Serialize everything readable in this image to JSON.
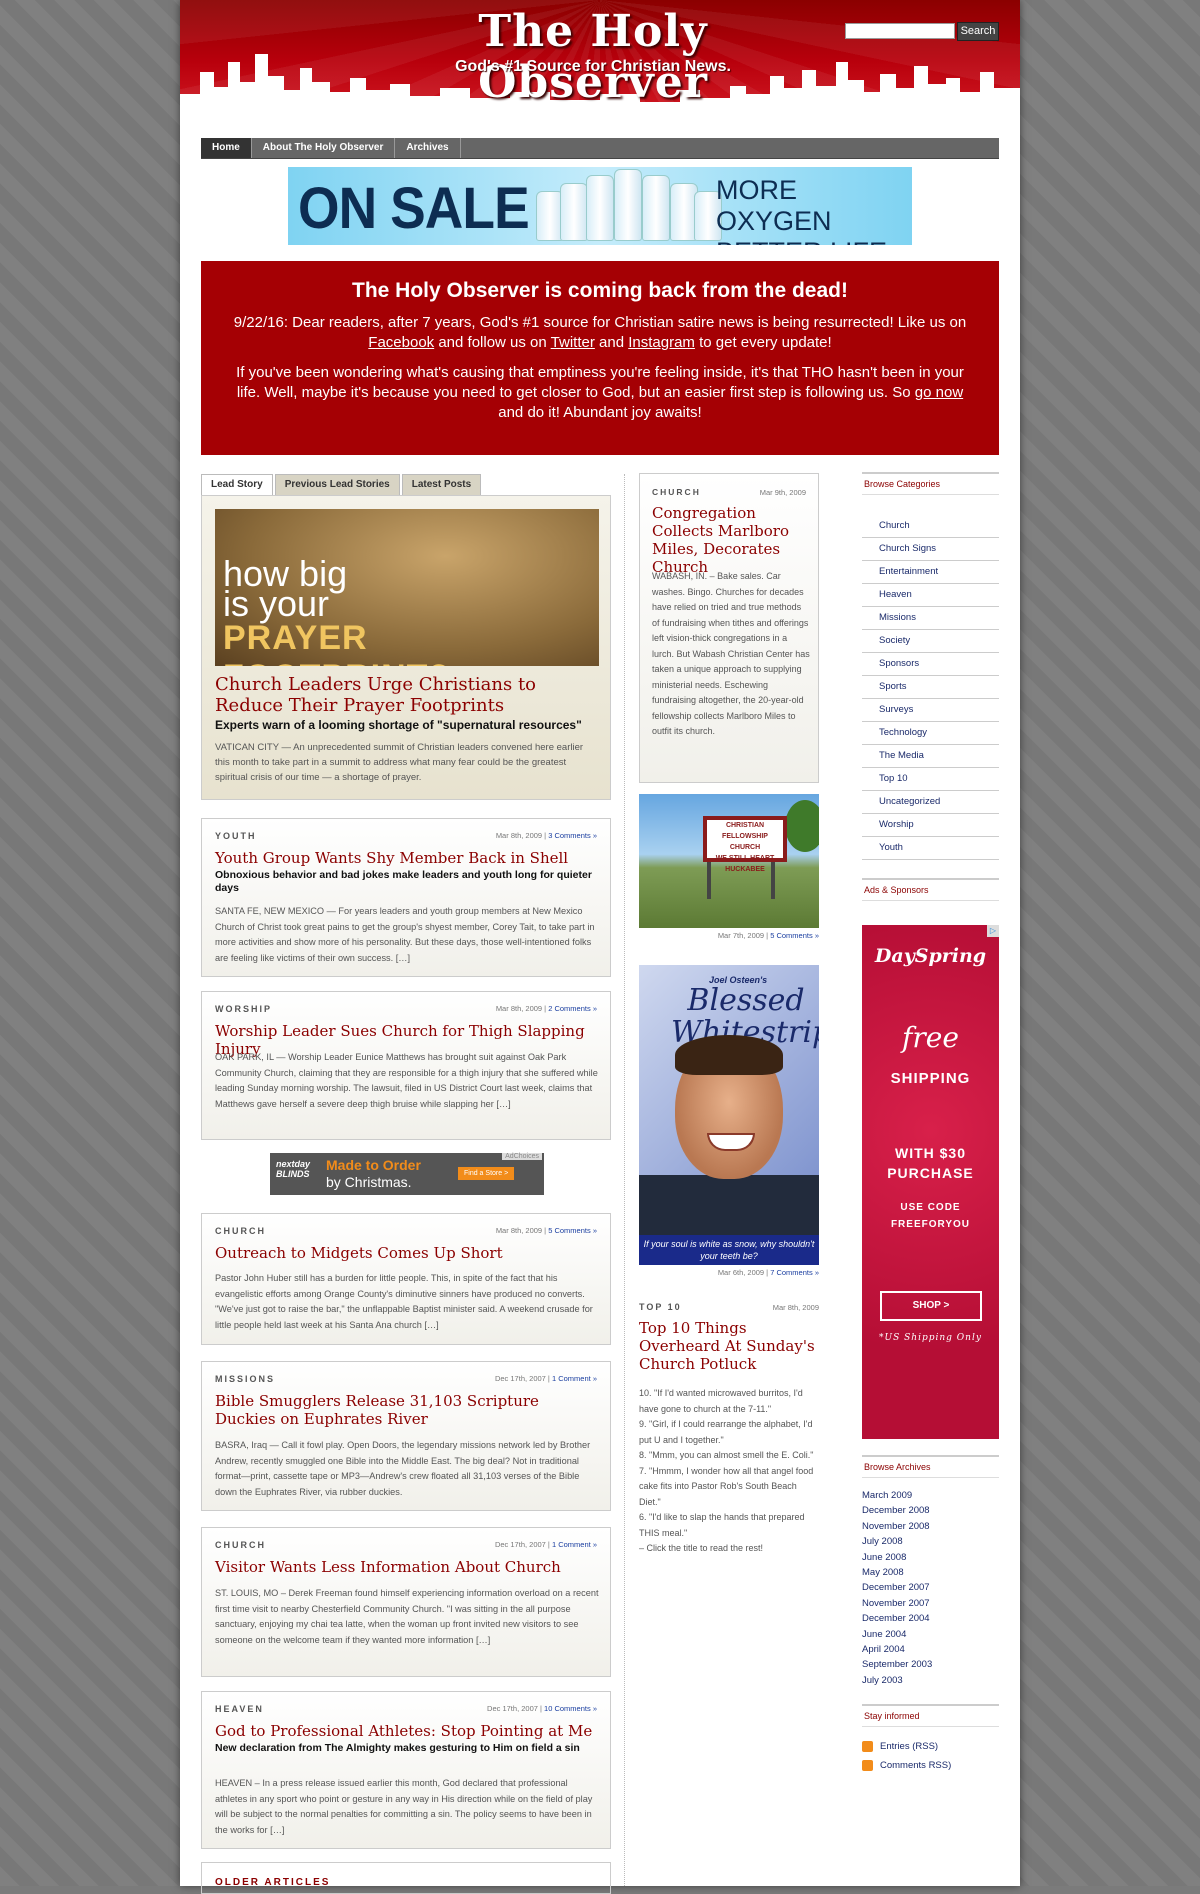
{
  "header": {
    "logo": "The Holy Observer",
    "tagline": "God's #1 Source for Christian News.",
    "search_button": "Search",
    "search_value": ""
  },
  "nav": [
    {
      "label": "Home"
    },
    {
      "label": "About The Holy Observer"
    },
    {
      "label": "Archives"
    }
  ],
  "banner_ad": {
    "headline": "ON SALE",
    "slogan_line1": "MORE OXYGEN",
    "slogan_line2": "BETTER LIFE",
    "accent": "#0d2d52"
  },
  "announcement": {
    "title": "The Holy Observer is coming back from the dead!",
    "p1_before": "9/22/16: Dear readers, after 7 years, God's #1 source for Christian satire news is being resurrected! Like us on ",
    "p1_link1": "Facebook",
    "p1_mid1": " and follow us on ",
    "p1_link2": "Twitter",
    "p1_mid2": " and ",
    "p1_link3": "Instagram",
    "p1_after": " to get every update!",
    "p2_before": "If you've been wondering what's causing that emptiness you're feeling inside, it's that THO hasn't been in your life. Well, maybe it's because you need to get closer to God, but an easier first step is following us. So ",
    "p2_link": "go now",
    "p2_after": " and do it! Abundant joy awaits!",
    "background": "#a50004"
  },
  "tabs": [
    {
      "label": "Lead Story"
    },
    {
      "label": "Previous Lead Stories"
    },
    {
      "label": "Latest Posts"
    }
  ],
  "lead": {
    "image_line1": "how big",
    "image_line2": "is your",
    "image_line3": "PRAYER FOOTPRINT?",
    "title": "Church Leaders Urge Christians to Reduce Their Prayer Footprints",
    "dek": "Experts warn of a looming shortage of \"supernatural resources\"",
    "excerpt": "VATICAN CITY — An unprecedented summit of Christian leaders convened here earlier this month to take part in a summit to address what many fear could be the greatest spiritual crisis of our time — a shortage of prayer."
  },
  "posts": [
    {
      "category": "YOUTH",
      "date": "Mar 8th, 2009 | ",
      "comments": "3 Comments »",
      "title": "Youth Group Wants Shy Member Back in Shell",
      "dek": "Obnoxious behavior and bad jokes make leaders and youth long for quieter days",
      "excerpt": "SANTA FE, NEW MEXICO — For years leaders and youth group members at New Mexico Church of Christ took great pains to get the group's shyest member, Corey Tait, to take part in more activities and show more of his personality. But these days, those well-intentioned folks are feeling like victims of their own success. […]"
    },
    {
      "category": "WORSHIP",
      "date": "Mar 8th, 2009 | ",
      "comments": "2 Comments »",
      "title": "Worship Leader Sues Church for Thigh Slapping Injury",
      "dek": "",
      "excerpt": "OAK PARK, IL — Worship Leader Eunice Matthews has brought suit against Oak Park Community Church, claiming that they are responsible for a thigh injury that she suffered while leading Sunday morning worship. The lawsuit, filed in US District Court last week, claims that Matthews gave herself a severe deep thigh bruise while slapping her […]"
    },
    {
      "category": "CHURCH",
      "date": "Mar 8th, 2009 | ",
      "comments": "5 Comments »",
      "title": "Outreach to Midgets Comes Up Short",
      "dek": "",
      "excerpt": "Pastor John Huber still has a burden for little people. This, in spite of the fact that his evangelistic efforts among Orange County's diminutive sinners have produced no converts. \"We've just got to raise the bar,\" the unflappable Baptist minister said. A weekend crusade for little people held last week at his Santa Ana church […]"
    },
    {
      "category": "MISSIONS",
      "date": "Dec 17th, 2007 | ",
      "comments": "1 Comment »",
      "title": "Bible Smugglers Release 31,103 Scripture Duckies on Euphrates River",
      "dek": "",
      "excerpt": "BASRA, Iraq — Call it fowl play. Open Doors, the legendary missions network led by Brother Andrew, recently smuggled one Bible into the Middle East. The big deal? Not in traditional format—print, cassette tape or MP3—Andrew's crew floated all 31,103 verses of the Bible down the Euphrates River, via rubber duckies."
    },
    {
      "category": "CHURCH",
      "date": "Dec 17th, 2007 | ",
      "comments": "1 Comment »",
      "title": "Visitor Wants Less Information About Church",
      "dek": "",
      "excerpt": "ST. LOUIS, MO – Derek Freeman found himself experiencing information overload on a recent first time visit to nearby Chesterfield Community Church. \"I was sitting in the all purpose sanctuary, enjoying my chai tea latte, when the woman up front invited new visitors to see someone on the welcome team if they wanted more information […]"
    },
    {
      "category": "HEAVEN",
      "date": "Dec 17th, 2007 | ",
      "comments": "10 Comments »",
      "title": "God to Professional Athletes: Stop Pointing at Me",
      "dek": "New declaration from The Almighty makes gesturing to Him on field a sin",
      "excerpt": "HEAVEN – In a press release issued earlier this month, God declared that professional athletes in any sport who point or gesture in any way in His direction while on the field of play will be subject to the normal penalties for committing a sin. The policy seems to have been in the works for […]"
    }
  ],
  "mid_ad": {
    "brand": "nextday BLINDS",
    "line1": "Made to Order",
    "line2": "by Christmas.",
    "cta": "Find a Store >",
    "adchoices": "AdChoices"
  },
  "older_articles": "OLDER ARTICLES",
  "mid_column": {
    "feature": {
      "category": "CHURCH",
      "date": "Mar 9th, 2009",
      "title": "Congregation Collects Marlboro Miles, Decorates Church",
      "excerpt": "WABASH, IN. – Bake sales. Car washes. Bingo. Churches for decades have relied on tried and true methods of fundraising when tithes and offerings left vision-thick congregations in a lurch. But Wabash Christian Center has taken a unique approach to supplying ministerial needs. Eschewing fundraising altogether, the 20-year-old fellowship collects Marlboro Miles to outfit its church."
    },
    "sign_photo": {
      "sign_line1": "CHRISTIAN FELLOWSHIP CHURCH",
      "sign_line2": "WE STILL HEART HUCKABEE",
      "date": "Mar 7th, 2009 | ",
      "comments": "5 Comments »"
    },
    "osteen_ad": {
      "byline": "Joel Osteen's",
      "title_line1": "Blessed",
      "title_line2": "Whitestrips",
      "quote": "If your soul is white as snow, why shouldn't your teeth be?",
      "date": "Mar 6th, 2009 | ",
      "comments": "7 Comments »"
    },
    "top10": {
      "category": "TOP 10",
      "date": "Mar 8th, 2009",
      "title": "Top 10 Things Overheard At Sunday's Church Potluck",
      "lines": [
        "10. \"If I'd wanted microwaved burritos, I'd have gone to church at the 7-11.\"",
        "9. \"Girl, if I could rearrange the alphabet, I'd put U and I together.\"",
        "8. \"Mmm, you can almost smell the E. Coli.\"",
        "7. \"Hmmm, I wonder how all that angel food cake fits into Pastor Rob's South Beach Diet.\"",
        "6. \"I'd like to slap the hands that prepared THIS meal.\"",
        "– Click the title to read the rest!"
      ]
    }
  },
  "sidebar": {
    "categories_title": "Browse Categories",
    "categories": [
      "Church",
      "Church Signs",
      "Entertainment",
      "Heaven",
      "Missions",
      "Society",
      "Sponsors",
      "Sports",
      "Surveys",
      "Technology",
      "The Media",
      "Top 10",
      "Uncategorized",
      "Worship",
      "Youth"
    ],
    "ads_title": "Ads & Sponsors",
    "dayspring": {
      "brand": "DaySpring",
      "free": "free",
      "shipping": "SHIPPING",
      "with_line1": "WITH $30",
      "with_line2": "PURCHASE",
      "code_line1": "USE CODE",
      "code_line2": "FREEFORYOU",
      "shop": "SHOP  >",
      "us": "*US Shipping Only"
    },
    "archives_title": "Browse Archives",
    "archives": [
      "March 2009",
      "December 2008",
      "November 2008",
      "July 2008",
      "June 2008",
      "May 2008",
      "December 2007",
      "November 2007",
      "December 2004",
      "June 2004",
      "April 2004",
      "September 2003",
      "July 2003"
    ],
    "stay_title": "Stay informed",
    "feeds": [
      "Entries (RSS)",
      "Comments RSS)"
    ]
  }
}
